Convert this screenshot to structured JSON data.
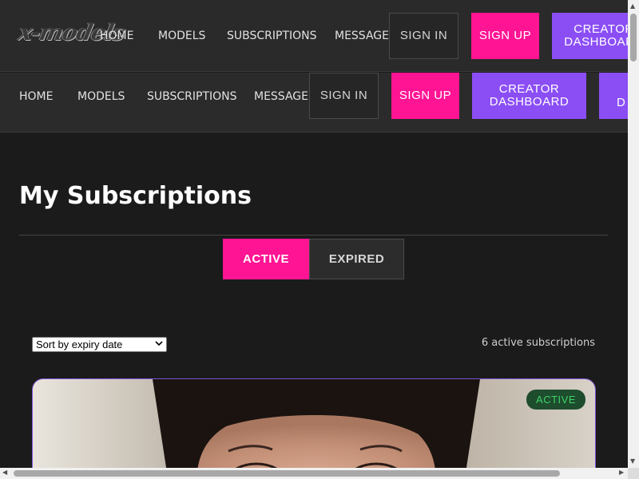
{
  "logo": {
    "text": "x-models"
  },
  "nav_top": {
    "home": "HOME",
    "models": "MODELS",
    "subscriptions": "SUBSCRIPTIONS",
    "messages": "MESSAGES",
    "sign_in": "SIGN IN",
    "sign_up": "SIGN UP",
    "creator_dashboard": "CREATOR DASHBOARD"
  },
  "nav_second": {
    "home": "HOME",
    "models": "MODELS",
    "subscriptions": "SUBSCRIPTIONS",
    "messages": "MESSAGES",
    "sign_in": "SIGN IN",
    "sign_up": "SIGN UP",
    "creator_dashboard": "CREATOR DASHBOARD",
    "extra_partial": "D"
  },
  "page": {
    "title": "My Subscriptions",
    "tabs": [
      {
        "label": "ACTIVE",
        "selected": true
      },
      {
        "label": "EXPIRED",
        "selected": false
      }
    ],
    "sort": {
      "selected": "Sort by expiry date"
    },
    "count_text": "6 active subscriptions"
  },
  "cards": [
    {
      "status": "ACTIVE"
    }
  ],
  "colors": {
    "accent_pink": "#ff1493",
    "accent_purple": "#8b4ef5",
    "status_green": "#3ed16a",
    "background": "#1b1b1b"
  },
  "icons": {
    "select_chevron": "chevron-down-icon",
    "scroll_up": "arrow-up-icon",
    "scroll_down": "arrow-down-icon",
    "scroll_left": "arrow-left-icon",
    "scroll_right": "arrow-right-icon"
  }
}
